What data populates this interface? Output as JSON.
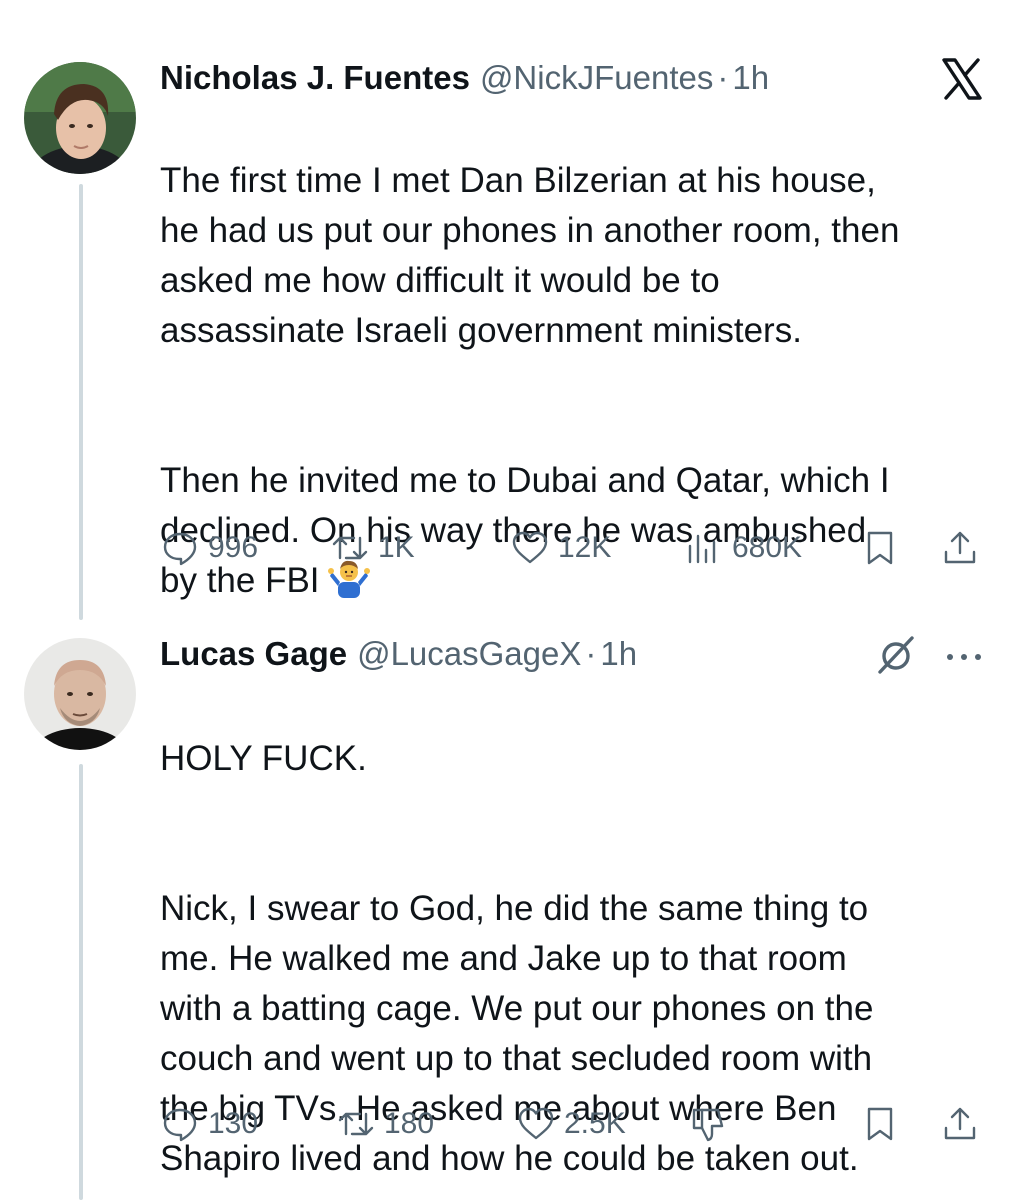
{
  "tweets": [
    {
      "author": {
        "name": "Nicholas J. Fuentes",
        "handle": "@NickJFuentes",
        "separator": "·",
        "time": "1h",
        "avatar": "avatar-nick"
      },
      "header_icon": "x-logo-icon",
      "body": [
        "The first time I met Dan Bilzerian at his house,\nhe had us put our phones in another room, then\nasked me how difficult it would be to\nassassinate Israeli government ministers.",
        "Then he invited me to Dubai and Qatar, which I\ndeclined. On his way there he was ambushed\nby the FBI"
      ],
      "emoji": "person-shrugging-emoji",
      "stats": {
        "replies": "996",
        "reposts": "1K",
        "likes": "12K",
        "views": "680K"
      }
    },
    {
      "author": {
        "name": "Lucas Gage",
        "handle": "@LucasGageX",
        "separator": "·",
        "time": "1h",
        "avatar": "avatar-lucas"
      },
      "header_icon": "grok-icon",
      "body": [
        "HOLY FUCK.",
        "Nick, I swear to God, he did the same thing to\nme. He walked me and Jake up to that room\nwith a batting cage. We put our phones on the\ncouch and went up to that secluded room with\nthe big TVs. He asked me about where Ben\nShapiro lived and how he could be taken out."
      ],
      "stats": {
        "replies": "130",
        "reposts": "180",
        "likes": "2.5K"
      }
    }
  ],
  "colors": {
    "text": "#0f1419",
    "secondary": "#536471",
    "thread_line": "#cfd9de",
    "background": "#ffffff"
  }
}
